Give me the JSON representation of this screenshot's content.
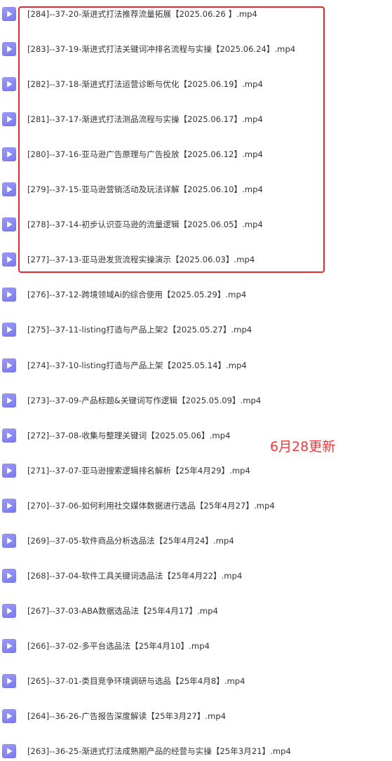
{
  "files": [
    {
      "name": "[284]--37-20-渐进式打法推荐流量拓展【2025.06.26 】.mp4"
    },
    {
      "name": "[283]--37-19-渐进式打法关键词冲排名流程与实操【2025.06.24】.mp4"
    },
    {
      "name": "[282]--37-18-渐进式打法运营诊断与优化【2025.06.19】.mp4"
    },
    {
      "name": "[281]--37-17-渐进式打法测品流程与实操【2025.06.17】.mp4"
    },
    {
      "name": "[280]--37-16-亚马逊广告原理与广告投放【2025.06.12】.mp4"
    },
    {
      "name": "[279]--37-15-亚马逊营销活动及玩法详解【2025.06.10】.mp4"
    },
    {
      "name": "[278]--37-14-初步认识亚马逊的流量逻辑【2025.06.05】.mp4"
    },
    {
      "name": "[277]--37-13-亚马逊发货流程实操演示【2025.06.03】.mp4"
    },
    {
      "name": "[276]--37-12-跨境领域Ai的综合使用【2025.05.29】.mp4"
    },
    {
      "name": "[275]--37-11-listing打造与产品上架2【2025.05.27】.mp4"
    },
    {
      "name": "[274]--37-10-listing打造与产品上架【2025.05.14】.mp4"
    },
    {
      "name": "[273]--37-09-产品标题&关键词写作逻辑【2025.05.09】.mp4"
    },
    {
      "name": "[272]--37-08-收集与整理关键词【2025.05.06】.mp4"
    },
    {
      "name": "[271]--37-07-亚马逊搜索逻辑排名解析【25年4月29】.mp4"
    },
    {
      "name": "[270]--37-06-如何利用社交媒体数据进行选品【25年4月27】.mp4"
    },
    {
      "name": "[269]--37-05-软件商品分析选品法【25年4月24】.mp4"
    },
    {
      "name": "[268]--37-04-软件工具关键词选品法【25年4月22】.mp4"
    },
    {
      "name": "[267]--37-03-ABA数据选品法【25年4月17】.mp4"
    },
    {
      "name": "[266]--37-02-多平台选品法【25年4月10】.mp4"
    },
    {
      "name": "[265]--37-01-类目竞争环境调研与选品【25年4月8】.mp4"
    },
    {
      "name": "[264]--36-26-广告报告深度解读【25年3月27】.mp4"
    },
    {
      "name": "[263]--36-25-渐进式打法成熟期产品的经营与实操【25年3月21】.mp4"
    }
  ],
  "file_icon": "video-file-icon",
  "annotation": {
    "text": "6月28更新",
    "color": "#f0393c"
  },
  "highlight": {
    "color": "#e8272b"
  }
}
